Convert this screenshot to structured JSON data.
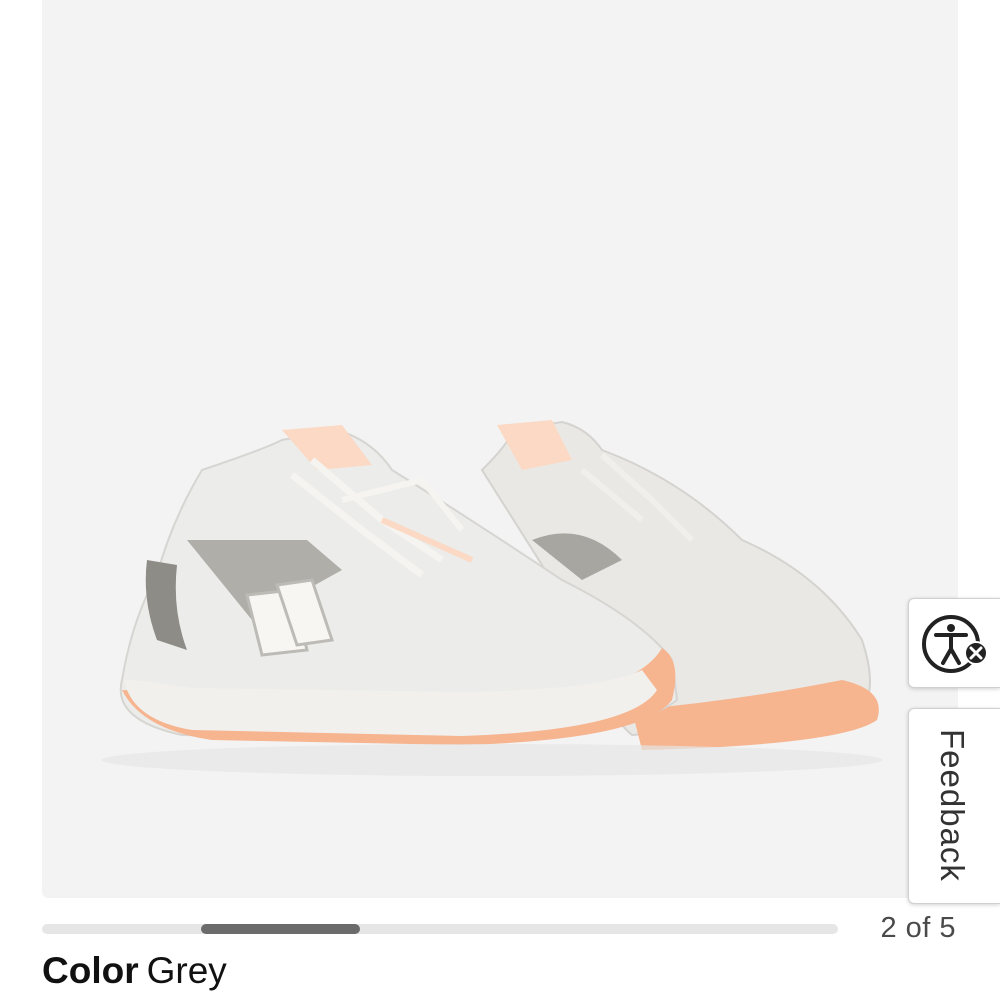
{
  "product": {
    "image_alt": "Grey running shoes with peach outsole",
    "color_label": "Color",
    "color_value": "Grey"
  },
  "carousel": {
    "current": 2,
    "total": 5,
    "counter_text": "2 of 5",
    "progress_start_fraction": 0.2,
    "progress_end_fraction": 0.4
  },
  "side_widgets": {
    "accessibility_icon": "accessibility-person-icon",
    "feedback_label": "Feedback"
  },
  "colors": {
    "image_background": "#f3f3f3",
    "shoe_upper": "#e9e8e4",
    "shoe_accent": "#9a9893",
    "outsole": "#f6b48f",
    "track": "#e6e6e6",
    "thumb": "#6b6b6b"
  }
}
